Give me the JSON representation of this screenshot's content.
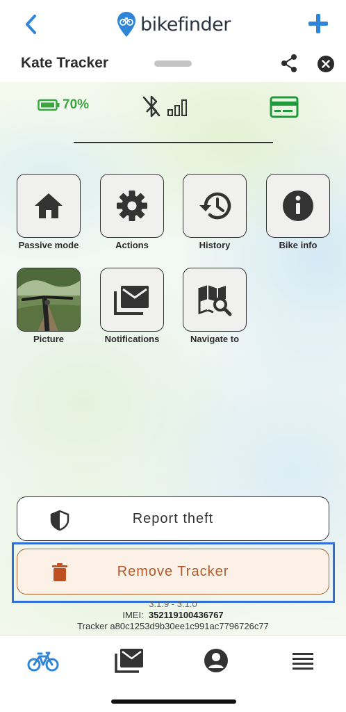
{
  "app": {
    "brand": "bikefinder"
  },
  "header": {
    "tracker_name": "Kate Tracker"
  },
  "status": {
    "battery_percent": "70%",
    "battery_level": 0.7
  },
  "tiles": [
    {
      "label": "Passive mode",
      "icon": "home-icon"
    },
    {
      "label": "Actions",
      "icon": "gear-icon"
    },
    {
      "label": "History",
      "icon": "history-icon"
    },
    {
      "label": "Bike info",
      "icon": "info-icon"
    },
    {
      "label": "Picture",
      "icon": "bike-photo"
    },
    {
      "label": "Notifications",
      "icon": "mail-stack-icon"
    },
    {
      "label": "Navigate to",
      "icon": "map-search-icon"
    }
  ],
  "actions": {
    "report_theft": "Report theft",
    "remove_tracker": "Remove Tracker"
  },
  "info": {
    "version": "3.1.9 - 3.1.0",
    "imei_label": "IMEI:",
    "imei_value": "352119100436767",
    "tracker_label": "Tracker a80c1253d9b30ee1c991ac7796726c77"
  },
  "tabbar": [
    "bike-icon",
    "mail-stack-icon",
    "account-icon",
    "menu-icon"
  ],
  "colors": {
    "accent": "#2f86d8",
    "battery_green": "#3aa640",
    "danger": "#b25a2a",
    "highlight": "#2f6fd6"
  }
}
